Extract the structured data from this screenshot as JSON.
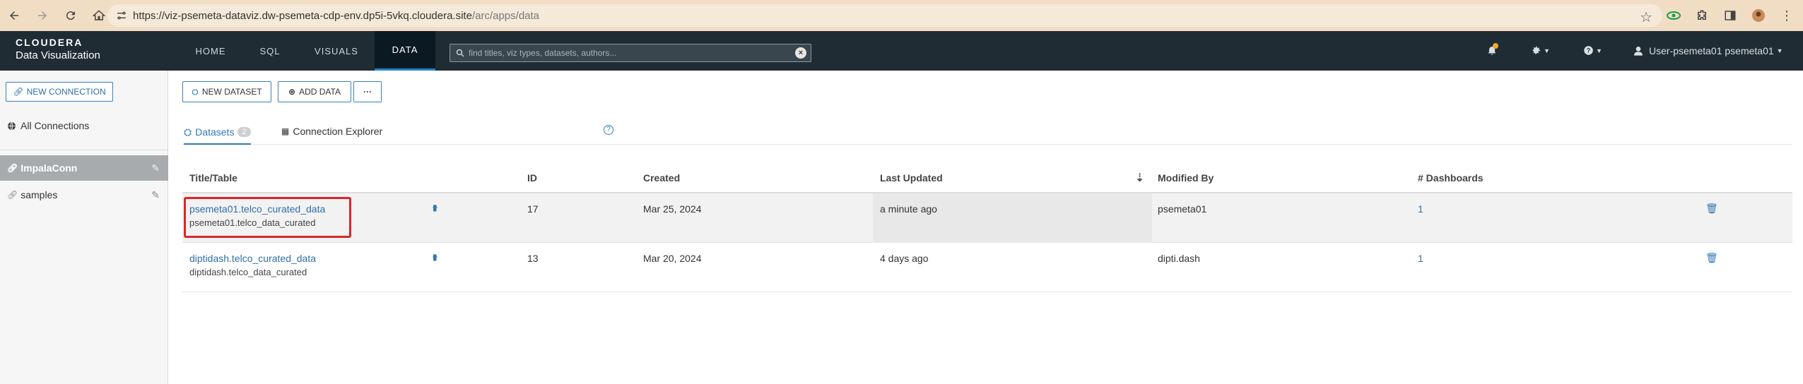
{
  "browser": {
    "url_main": "https://viz-psemeta-dataviz.dw-psemeta-cdp-env.dp5i-5vkq.cloudera.site",
    "url_path": "/arc/apps/data"
  },
  "header": {
    "brand_top": "CLOUDERA",
    "brand_bottom": "Data Visualization",
    "nav": [
      {
        "label": "HOME"
      },
      {
        "label": "SQL"
      },
      {
        "label": "VISUALS"
      },
      {
        "label": "DATA"
      }
    ],
    "search_placeholder": "find titles, viz types, datasets, authors...",
    "user_label": "User-psemeta01 psemeta01"
  },
  "sidebar": {
    "new_connection_label": "NEW CONNECTION",
    "all_connections_label": "All Connections",
    "connections": [
      {
        "label": "ImpalaConn",
        "active": true
      },
      {
        "label": "samples",
        "active": false
      }
    ]
  },
  "toolbar": {
    "new_dataset_label": "NEW DATASET",
    "add_data_label": "ADD DATA",
    "more_label": "···"
  },
  "tabs": {
    "datasets_label": "Datasets",
    "datasets_count": "2",
    "explorer_label": "Connection Explorer",
    "help_label": "?"
  },
  "table": {
    "headers": {
      "title": "Title/Table",
      "id": "ID",
      "created": "Created",
      "updated": "Last Updated",
      "modified": "Modified By",
      "dashboards": "# Dashboards"
    },
    "rows": [
      {
        "title": "psemeta01.telco_curated_data",
        "table": "psemeta01.telco_data_curated",
        "add_viz": "+",
        "id": "17",
        "created": "Mar 25, 2024",
        "updated": "a minute ago",
        "modified_by": "psemeta01",
        "dashboards": "1"
      },
      {
        "title": "diptidash.telco_curated_data",
        "table": "diptidash.telco_data_curated",
        "add_viz": "+",
        "id": "13",
        "created": "Mar 20, 2024",
        "updated": "4 days ago",
        "modified_by": "dipti.dash",
        "dashboards": "1"
      }
    ]
  },
  "colors": {
    "accent": "#2f78b7",
    "header_bg": "#1f2c34",
    "highlight_border": "#d9262c"
  }
}
